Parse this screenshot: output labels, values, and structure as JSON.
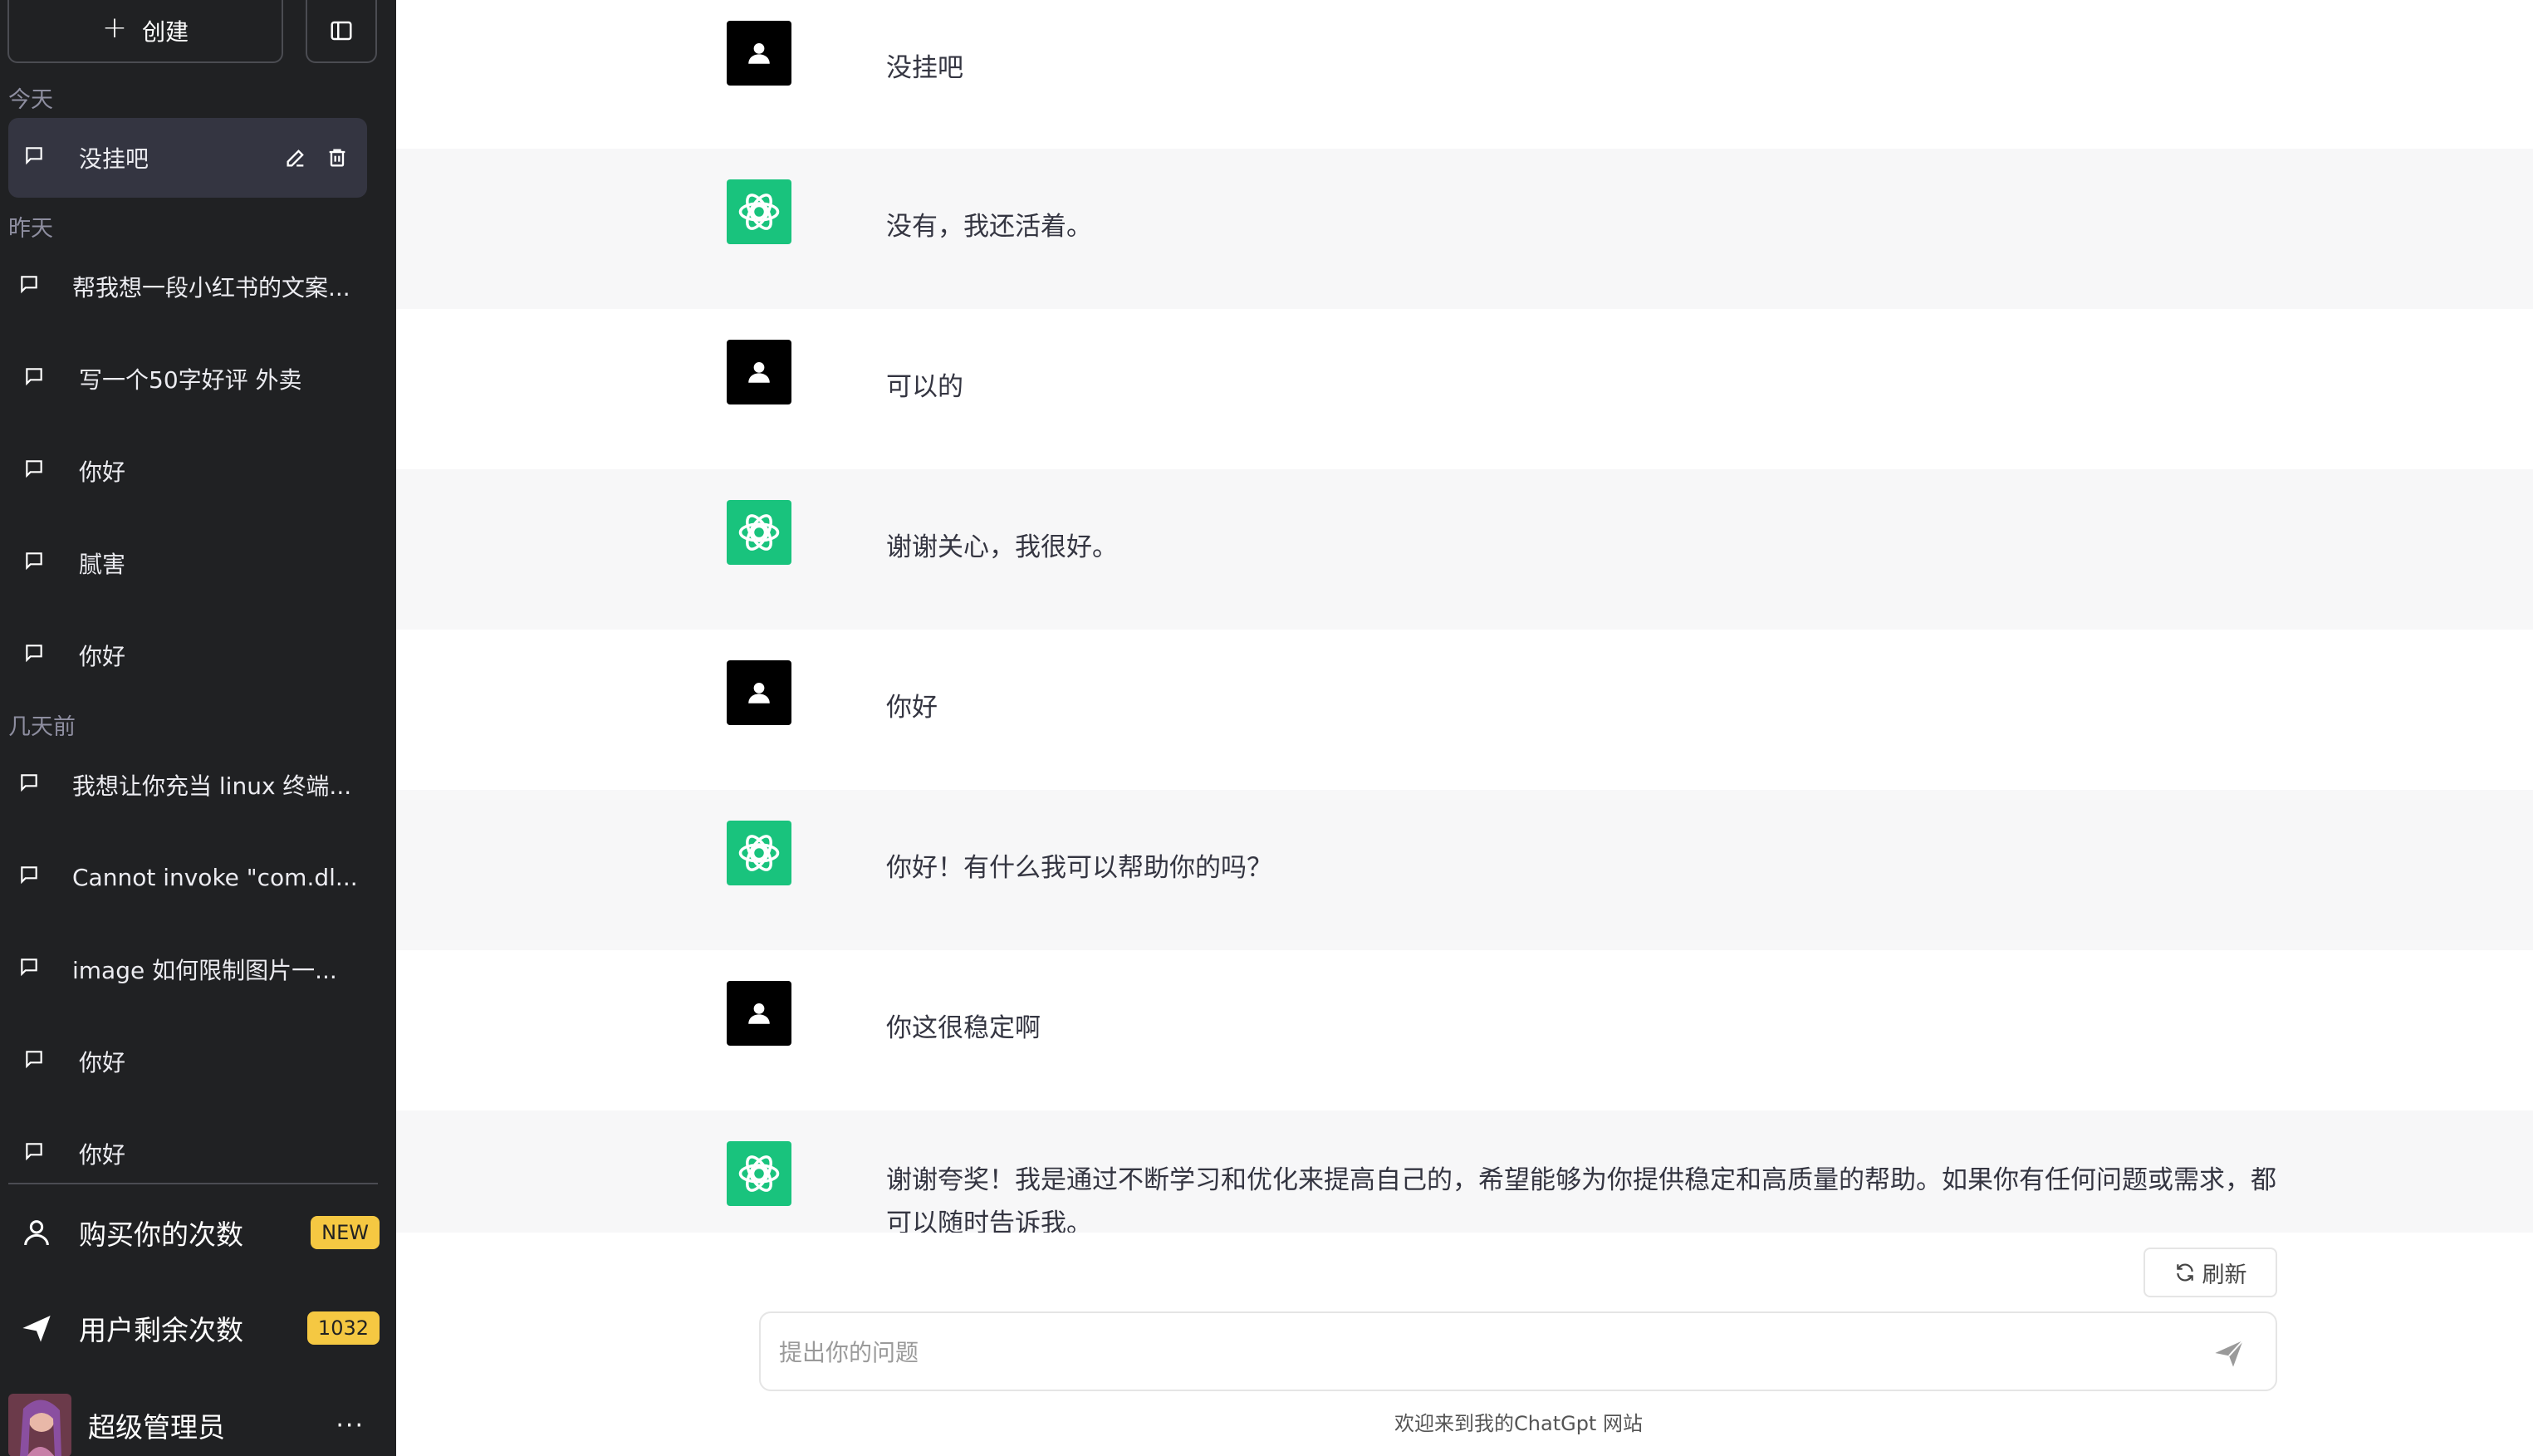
{
  "sidebar": {
    "new_label": "创建",
    "groups": {
      "today": "今天",
      "yesterday": "昨天",
      "days_ago": "几天前"
    },
    "conversations": [
      {
        "label": "没挂吧",
        "group": "today",
        "active": true
      },
      {
        "label": "帮我想一段小红书的文案...",
        "group": "yesterday"
      },
      {
        "label": "写一个50字好评 外卖",
        "group": "yesterday"
      },
      {
        "label": "你好",
        "group": "yesterday"
      },
      {
        "label": "腻害",
        "group": "yesterday"
      },
      {
        "label": "你好",
        "group": "yesterday"
      },
      {
        "label": "我想让你充当 linux 终端...",
        "group": "days_ago"
      },
      {
        "label": "Cannot invoke \"com.dl...",
        "group": "days_ago"
      },
      {
        "label": "image 如何限制图片一...",
        "group": "days_ago"
      },
      {
        "label": "你好",
        "group": "days_ago"
      },
      {
        "label": "你好",
        "group": "days_ago"
      }
    ],
    "buy": {
      "label": "购买你的次数",
      "badge": "NEW"
    },
    "remaining": {
      "label": "用户剩余次数",
      "badge": "1032"
    },
    "user": {
      "name": "超级管理员",
      "more": "···"
    }
  },
  "messages": [
    {
      "role": "user",
      "text": "没挂吧"
    },
    {
      "role": "bot",
      "text": "没有，我还活着。"
    },
    {
      "role": "user",
      "text": "可以的"
    },
    {
      "role": "bot",
      "text": "谢谢关心，我很好。"
    },
    {
      "role": "user",
      "text": "你好"
    },
    {
      "role": "bot",
      "text": "你好！有什么我可以帮助你的吗？"
    },
    {
      "role": "user",
      "text": "你这很稳定啊"
    },
    {
      "role": "bot",
      "text": "谢谢夸奖！我是通过不断学习和优化来提高自己的，希望能够为你提供稳定和高质量的帮助。如果你有任何问题或需求，都可以随时告诉我。"
    }
  ],
  "refresh_label": "刷新",
  "input": {
    "placeholder": "提出你的问题",
    "value": ""
  },
  "footer": "欢迎来到我的ChatGpt 网站",
  "colors": {
    "sidebar_bg": "#202123",
    "bot_bg": "#f7f7f8",
    "openai_green": "#19c37d",
    "badge": "#f5c842"
  }
}
